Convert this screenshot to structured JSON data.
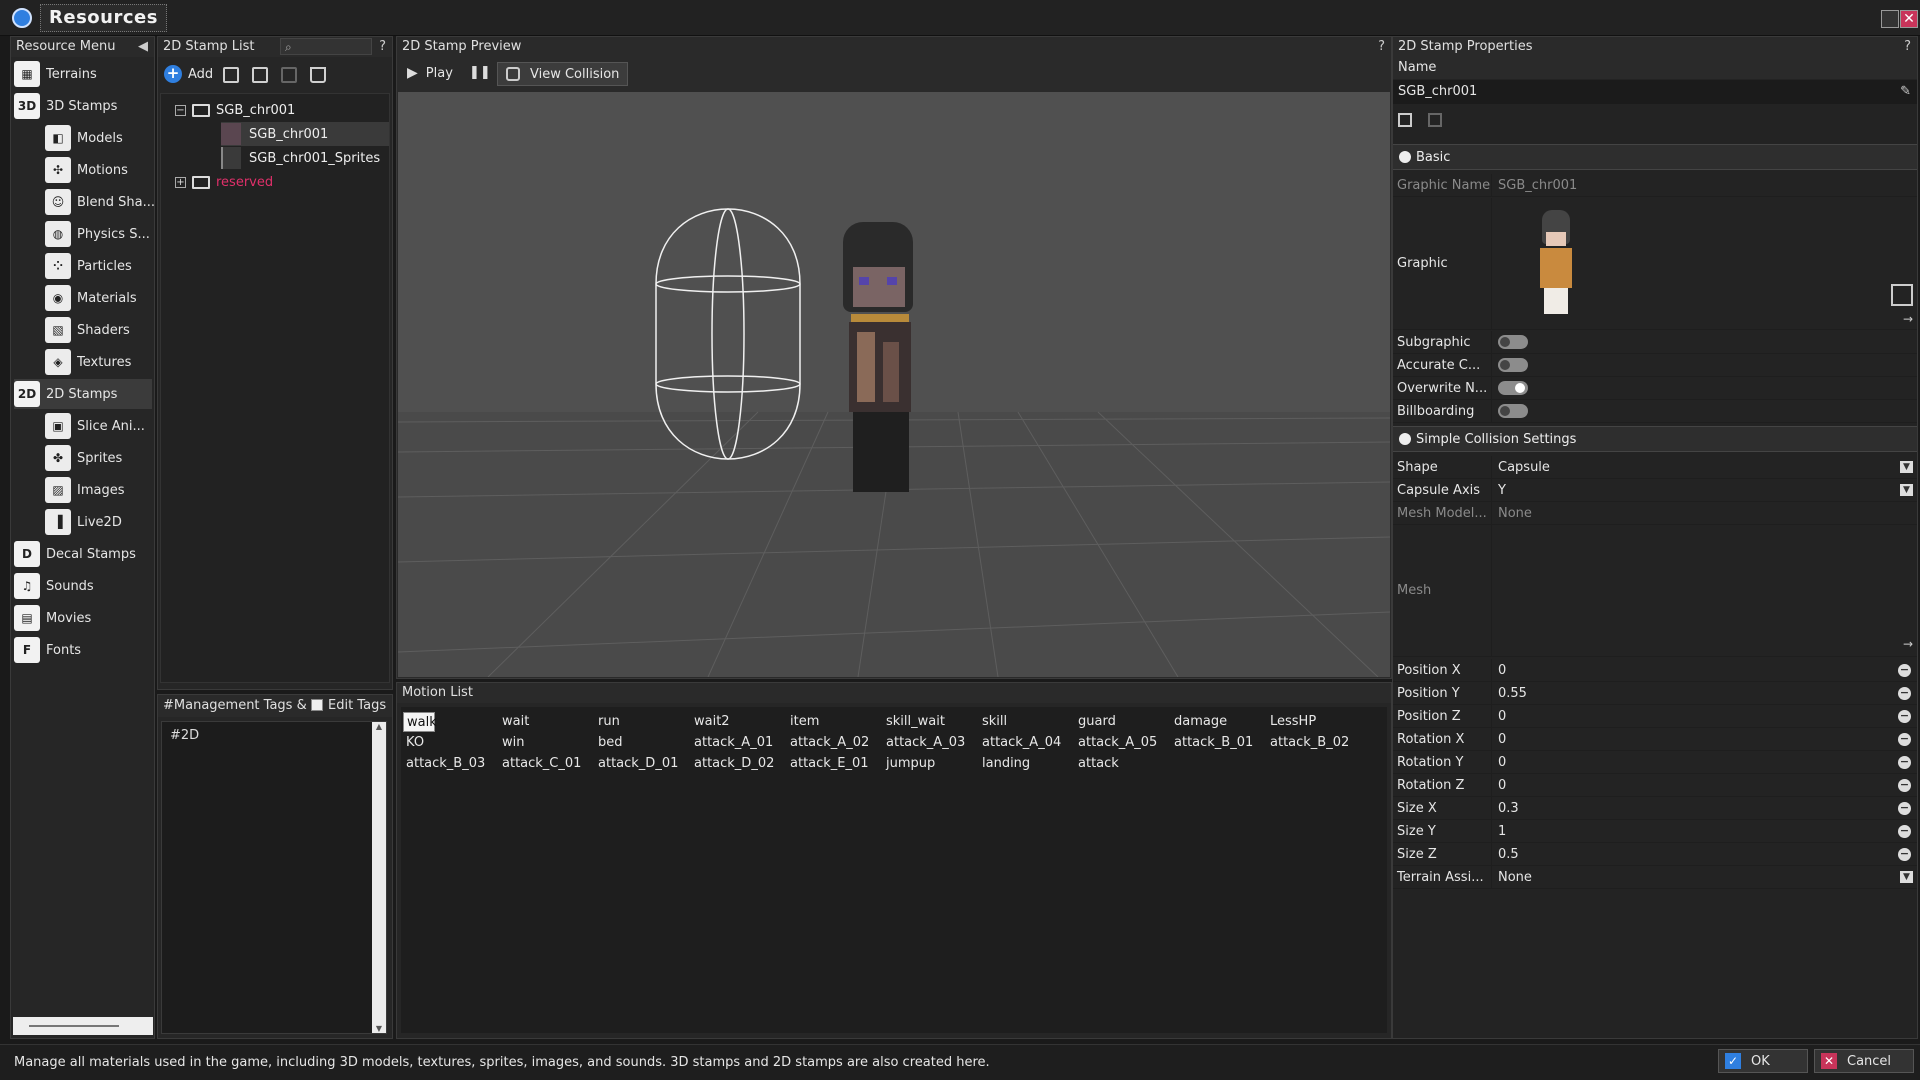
{
  "window": {
    "title": "Resources",
    "close_glyph": "✕"
  },
  "resource_menu": {
    "header": "Resource Menu",
    "items": [
      {
        "label": "Terrains",
        "icon": "terrain-icon",
        "glyph": "▦",
        "level": 0
      },
      {
        "label": "3D Stamps",
        "icon": "3d-stamps-icon",
        "glyph": "3D",
        "level": 0
      },
      {
        "label": "Models",
        "icon": "model-icon",
        "glyph": "◧",
        "level": 1
      },
      {
        "label": "Motions",
        "icon": "motion-icon",
        "glyph": "✣",
        "level": 1
      },
      {
        "label": "Blend Sha...",
        "icon": "blend-shape-icon",
        "glyph": "☺",
        "level": 1
      },
      {
        "label": "Physics S...",
        "icon": "physics-icon",
        "glyph": "◍",
        "level": 1
      },
      {
        "label": "Particles",
        "icon": "particles-icon",
        "glyph": "⁘",
        "level": 1
      },
      {
        "label": "Materials",
        "icon": "materials-icon",
        "glyph": "◉",
        "level": 1
      },
      {
        "label": "Shaders",
        "icon": "shaders-icon",
        "glyph": "▧",
        "level": 1
      },
      {
        "label": "Textures",
        "icon": "textures-icon",
        "glyph": "◈",
        "level": 1
      },
      {
        "label": "2D Stamps",
        "icon": "2d-stamps-icon",
        "glyph": "2D",
        "level": 0,
        "selected": true
      },
      {
        "label": "Slice Ani...",
        "icon": "slice-anim-icon",
        "glyph": "▣",
        "level": 1
      },
      {
        "label": "Sprites",
        "icon": "sprites-icon",
        "glyph": "✤",
        "level": 1
      },
      {
        "label": "Images",
        "icon": "images-icon",
        "glyph": "▨",
        "level": 1
      },
      {
        "label": "Live2D",
        "icon": "live2d-icon",
        "glyph": "▐",
        "level": 1
      },
      {
        "label": "Decal Stamps",
        "icon": "decal-icon",
        "glyph": "D",
        "level": 0
      },
      {
        "label": "Sounds",
        "icon": "sounds-icon",
        "glyph": "♫",
        "level": 0
      },
      {
        "label": "Movies",
        "icon": "movies-icon",
        "glyph": "▤",
        "level": 0
      },
      {
        "label": "Fonts",
        "icon": "fonts-icon",
        "glyph": "F",
        "level": 0
      }
    ]
  },
  "stamp_list": {
    "header": "2D Stamp List",
    "help": "?",
    "add_label": "Add",
    "tree": [
      {
        "label": "SGB_chr001",
        "type": "folder"
      },
      {
        "label": "SGB_chr001",
        "type": "item",
        "selected": true
      },
      {
        "label": "SGB_chr001_Sprites",
        "type": "item"
      },
      {
        "label": "reserved",
        "type": "folder",
        "color": "#e0306a"
      }
    ]
  },
  "tags": {
    "header": "#Management Tags & I",
    "edit_label": "Edit Tags",
    "content": "#2D"
  },
  "preview": {
    "header": "2D Stamp Preview",
    "help": "?",
    "play_label": "Play",
    "view_collision_label": "View Collision"
  },
  "motion_list": {
    "header": "Motion List",
    "rows": [
      [
        "walk",
        "wait",
        "run",
        "wait2",
        "item",
        "skill_wait",
        "skill",
        "guard",
        "damage",
        "LessHP"
      ],
      [
        "KO",
        "win",
        "bed",
        "attack_A_01",
        "attack_A_02",
        "attack_A_03",
        "attack_A_04",
        "attack_A_05",
        "attack_B_01",
        "attack_B_02"
      ],
      [
        "attack_B_03",
        "attack_C_01",
        "attack_D_01",
        "attack_D_02",
        "attack_E_01",
        "jumpup",
        "landing",
        "attack"
      ]
    ]
  },
  "properties": {
    "header": "2D Stamp Properties",
    "help": "?",
    "name_label": "Name",
    "name_value": "SGB_chr001",
    "basic_section": "Basic",
    "graphic_name_label": "Graphic Name",
    "graphic_name_value": "SGB_chr001",
    "graphic_label": "Graphic",
    "subgraphic_label": "Subgraphic",
    "accurate_label": "Accurate C...",
    "overwrite_label": "Overwrite N...",
    "billboarding_label": "Billboarding",
    "collision_section": "Simple Collision Settings",
    "shape_label": "Shape",
    "shape_value": "Capsule",
    "capsule_axis_label": "Capsule Axis",
    "capsule_axis_value": "Y",
    "mesh_model_label": "Mesh Model...",
    "mesh_model_value": "None",
    "mesh_label": "Mesh",
    "transform": [
      {
        "label": "Position X",
        "value": "0"
      },
      {
        "label": "Position Y",
        "value": "0.55"
      },
      {
        "label": "Position Z",
        "value": "0"
      },
      {
        "label": "Rotation X",
        "value": "0"
      },
      {
        "label": "Rotation Y",
        "value": "0"
      },
      {
        "label": "Rotation Z",
        "value": "0"
      },
      {
        "label": "Size X",
        "value": "0.3"
      },
      {
        "label": "Size Y",
        "value": "1"
      },
      {
        "label": "Size Z",
        "value": "0.5"
      }
    ],
    "terrain_label": "Terrain Assi...",
    "terrain_value": "None"
  },
  "status": {
    "message": "Manage all materials used in the game, including 3D models, textures, sprites, images, and sounds. 3D stamps and 2D stamps are also created here.",
    "ok_label": "OK",
    "cancel_label": "Cancel"
  },
  "colors": {
    "accent": "#2f7fe0",
    "cancel": "#c8345a",
    "reserved": "#e0306a"
  }
}
